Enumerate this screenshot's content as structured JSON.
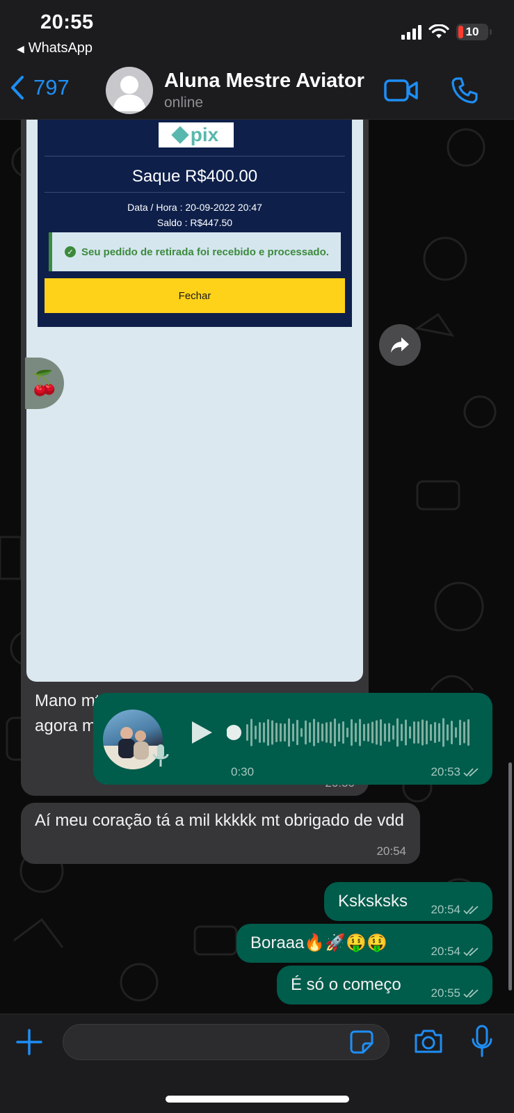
{
  "status_bar": {
    "time": "20:55",
    "back_app": "WhatsApp",
    "battery": "10"
  },
  "header": {
    "back_count": "797",
    "contact_name": "Aluna Mestre Aviator",
    "contact_status": "online"
  },
  "messages": {
    "image_message": {
      "pix_logo": "pix",
      "pix_title": "Saque R$400.00",
      "pix_datetime": "Data / Hora : 20-09-2022 20:47",
      "pix_balance": "Saldo : R$447.50",
      "pix_success": "Seu pedido de retirada foi recebido e processado.",
      "pix_button": "Fechar",
      "caption": "Mano mt obrigado, eu saquei 400 reais agora meu deus tô nem acreditando",
      "time": "20:50"
    },
    "voice_message": {
      "duration": "0:30",
      "time": "20:53",
      "progress": 0
    },
    "incoming_2": {
      "text": "Aí meu coração tá a mil kkkkk mt obrigado de vdd",
      "time": "20:54"
    },
    "outgoing": [
      {
        "text": "Ksksksks",
        "time": "20:54"
      },
      {
        "text": "Boraaa🔥🚀🤑🤑",
        "time": "20:54"
      },
      {
        "text": "É só o começo",
        "time": "20:55"
      }
    ]
  },
  "input_bar": {
    "placeholder": ""
  },
  "colors": {
    "accent": "#1e8ef5",
    "outgoing_bubble": "#005c4b",
    "incoming_bubble": "#363638",
    "pix_card": "#0e1f4a",
    "pix_button": "#ffd21a"
  },
  "icons": {
    "back": "chevron-left-icon",
    "video": "video-camera-icon",
    "call": "phone-icon",
    "forward": "forward-arrow-icon",
    "play": "play-icon",
    "mic": "microphone-icon",
    "plus": "plus-icon",
    "sticker": "sticker-icon",
    "camera": "camera-icon",
    "read": "double-check-icon"
  }
}
